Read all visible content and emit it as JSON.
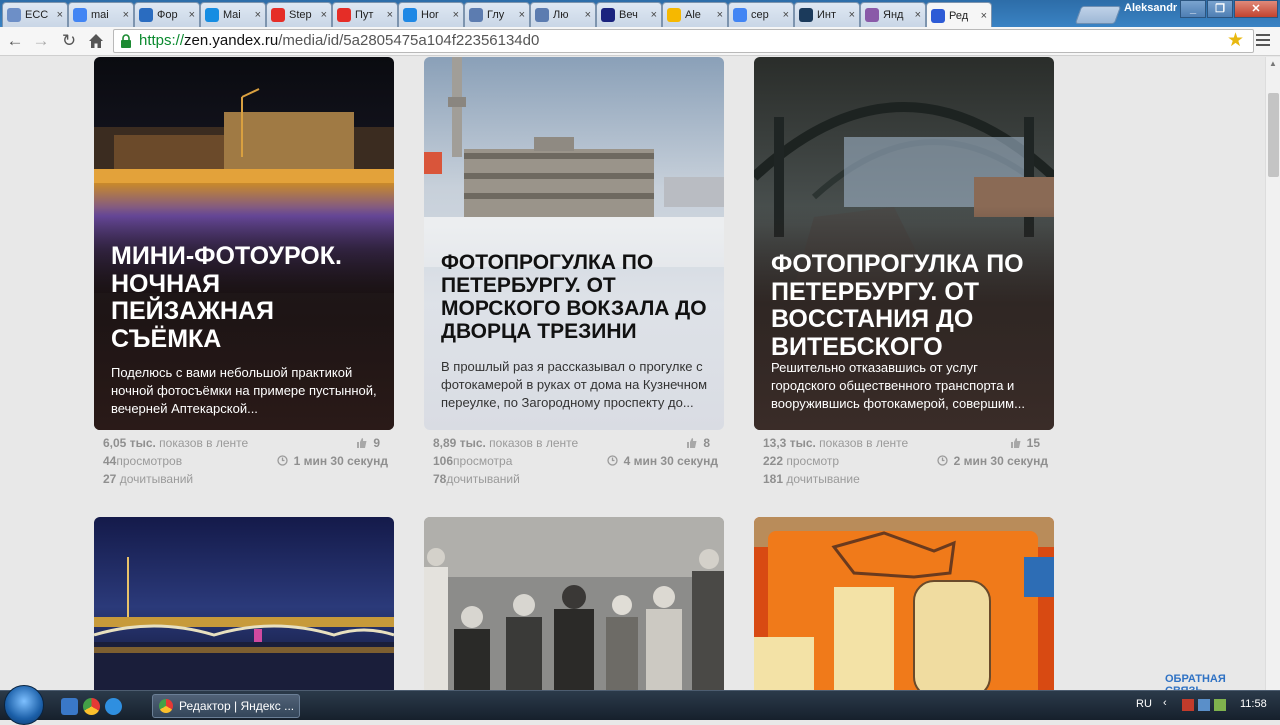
{
  "browser": {
    "tabs": [
      {
        "label": "ECC",
        "icon": "doc-icon",
        "color": "#6d8fc7"
      },
      {
        "label": "mai",
        "icon": "google-icon",
        "color": "#4285f4"
      },
      {
        "label": "Фор",
        "icon": "globe-icon",
        "color": "#2a6cc0"
      },
      {
        "label": "Mai",
        "icon": "mailru-icon",
        "color": "#168de2"
      },
      {
        "label": "Step",
        "icon": "youtube-icon",
        "color": "#e52d27"
      },
      {
        "label": "Пут",
        "icon": "youtube-icon",
        "color": "#e52d27"
      },
      {
        "label": "Hor",
        "icon": "bird-icon",
        "color": "#1e88e5"
      },
      {
        "label": "Глу",
        "icon": "circle-icon",
        "color": "#5c7cb0"
      },
      {
        "label": "Лю",
        "icon": "circle-icon",
        "color": "#5c7cb0"
      },
      {
        "label": "Веч",
        "icon": "news-icon",
        "color": "#1a237e"
      },
      {
        "label": "Ale",
        "icon": "note-icon",
        "color": "#f6b800"
      },
      {
        "label": "сер",
        "icon": "google-icon",
        "color": "#4285f4"
      },
      {
        "label": "Инт",
        "icon": "wave-icon",
        "color": "#1b3a5b"
      },
      {
        "label": "Янд",
        "icon": "person-icon",
        "color": "#8a5aa8"
      },
      {
        "label": "Ред",
        "icon": "zen-icon",
        "color": "#2d5bd6"
      }
    ],
    "user_name": "Aleksandr",
    "url_scheme": "https://",
    "url_host": "zen.yandex.ru",
    "url_path": "/media/id/5a2805475a104f22356134d0"
  },
  "cards": [
    {
      "title": "МИНИ-ФОТОУРОК. НОЧНАЯ ПЕЙЗАЖНАЯ СЪЁМКА",
      "snippet": "Поделюсь с вами небольшой практикой ночной фотосъёмки на примере пустынной, вечерней Аптекарской...",
      "stats": {
        "impressions": "6,05 тыс.",
        "impressions_label": "показов в ленте",
        "views": "44",
        "views_label": "просмотров",
        "reads": "27",
        "reads_label": "дочитываний",
        "likes": "9",
        "read_time": "1 мин 30 секунд"
      }
    },
    {
      "title": "ФОТОПРОГУЛКА ПО ПЕТЕРБУРГУ. ОТ МОРСКОГО ВОКЗАЛА ДО ДВОРЦА ТРЕЗИНИ",
      "snippet": "В прошлый раз я рассказывал о прогулке с фотокамерой в руках от дома на Кузнечном переулке, по Загородному проспекту до...",
      "stats": {
        "impressions": "8,89 тыс.",
        "impressions_label": "показов в ленте",
        "views": "106",
        "views_label": "просмотра",
        "reads": "78",
        "reads_label": "дочитываний",
        "likes": "8",
        "read_time": "4 мин 30 секунд"
      }
    },
    {
      "title": "ФОТОПРОГУЛКА ПО ПЕТЕРБУРГУ. ОТ ВОССТАНИЯ ДО ВИТЕБСКОГО",
      "snippet": "Решительно отказавшись от услуг городского общественного транспорта и вооружившись фотокамерой, совершим...",
      "stats": {
        "impressions": "13,3 тыс.",
        "impressions_label": "показов в ленте",
        "views": "222",
        "views_label": "просмотр",
        "reads": "181",
        "reads_label": "дочитывание",
        "likes": "15",
        "read_time": "2 мин 30 секунд"
      }
    }
  ],
  "feedback_link": "ОБРАТНАЯ СВЯЗЬ",
  "taskbar": {
    "task_label": "Редактор | Яндекс ...",
    "language": "RU",
    "time": "11:58"
  }
}
